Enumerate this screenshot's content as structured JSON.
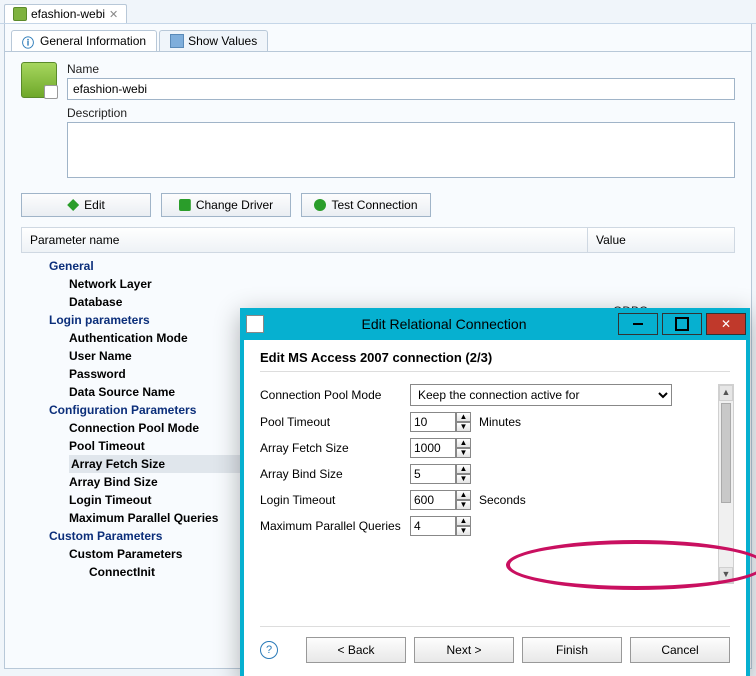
{
  "fileTab": {
    "title": "efashion-webi"
  },
  "innerTabs": {
    "general": "General Information",
    "showValues": "Show Values"
  },
  "general": {
    "nameLabel": "Name",
    "nameValue": "efashion-webi",
    "descLabel": "Description",
    "descValue": ""
  },
  "buttons": {
    "edit": "Edit",
    "changeDriver": "Change Driver",
    "testConnection": "Test Connection"
  },
  "paramHeader": {
    "name": "Parameter name",
    "value": "Value"
  },
  "tree": {
    "general": "General",
    "networkLayer": "Network Layer",
    "database": "Database",
    "loginParams": "Login parameters",
    "authMode": "Authentication Mode",
    "userName": "User Name",
    "password": "Password",
    "dataSourceName": "Data Source Name",
    "configParams": "Configuration Parameters",
    "connPoolMode": "Connection Pool Mode",
    "poolTimeout": "Pool Timeout",
    "arrayFetchSize": "Array Fetch Size",
    "arrayBindSize": "Array Bind Size",
    "loginTimeout": "Login Timeout",
    "maxParallel": "Maximum Parallel Queries",
    "customParams": "Custom Parameters",
    "customParams2": "Custom Parameters",
    "connectInit": "ConnectInit"
  },
  "valueHint": "ODBC",
  "dialog": {
    "title": "Edit Relational Connection",
    "heading": "Edit MS Access 2007 connection (2/3)",
    "labels": {
      "connPoolMode": "Connection Pool Mode",
      "poolTimeout": "Pool Timeout",
      "arrayFetch": "Array Fetch Size",
      "arrayBind": "Array Bind Size",
      "loginTimeout": "Login Timeout",
      "maxParallel": "Maximum Parallel Queries"
    },
    "values": {
      "connPoolMode": "Keep the connection active for",
      "poolTimeout": "10",
      "poolTimeoutUnit": "Minutes",
      "arrayFetch": "1000",
      "arrayBind": "5",
      "loginTimeout": "600",
      "loginTimeoutUnit": "Seconds",
      "maxParallel": "4"
    },
    "btns": {
      "back": "< Back",
      "next": "Next >",
      "finish": "Finish",
      "cancel": "Cancel"
    }
  }
}
